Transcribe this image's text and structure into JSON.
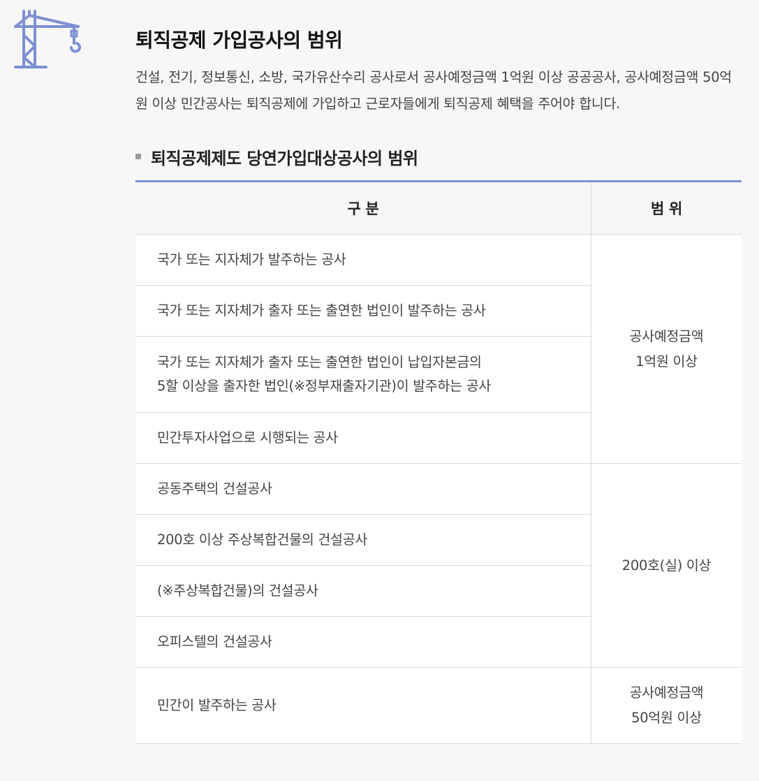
{
  "header": {
    "title": "퇴직공제 가입공사의 범위",
    "description": "건설, 전기, 정보통신, 소방, 국가유산수리 공사로서 공사예정금액 1억원 이상 공공공사, 공사예정금액 50억원 이상 민간공사는 퇴직공제에 가입하고 근로자들에게 퇴직공제 혜택을 주어야 합니다."
  },
  "section": {
    "subtitle": "퇴직공제제도 당연가입대상공사의 범위"
  },
  "table": {
    "headers": [
      "구 분",
      "범 위"
    ],
    "groups": [
      {
        "range_lines": [
          "공사예정금액",
          "1억원 이상"
        ],
        "items": [
          {
            "lines": [
              "국가 또는 지자체가 발주하는 공사"
            ]
          },
          {
            "lines": [
              "국가 또는 지자체가 출자 또는 출연한 법인이 발주하는 공사"
            ]
          },
          {
            "lines": [
              "국가 또는 지자체가 출자 또는 출연한 법인이 납입자본금의",
              "5할 이상을 출자한 법인(※정부재출자기관)이 발주하는 공사"
            ]
          },
          {
            "lines": [
              "민간투자사업으로 시행되는 공사"
            ]
          }
        ]
      },
      {
        "range_lines": [
          "200호(실) 이상"
        ],
        "items": [
          {
            "lines": [
              "공동주택의 건설공사"
            ]
          },
          {
            "lines": [
              "200호 이상 주상복합건물의 건설공사"
            ]
          },
          {
            "lines": [
              "(※주상복합건물)의 건설공사"
            ]
          },
          {
            "lines": [
              "오피스텔의 건설공사"
            ]
          }
        ]
      },
      {
        "range_lines": [
          "공사예정금액",
          "50억원 이상"
        ],
        "items": [
          {
            "lines": [
              "민간이 발주하는 공사"
            ]
          }
        ]
      }
    ]
  },
  "icon": {
    "name": "crane-icon",
    "color": "#7d90d3"
  }
}
